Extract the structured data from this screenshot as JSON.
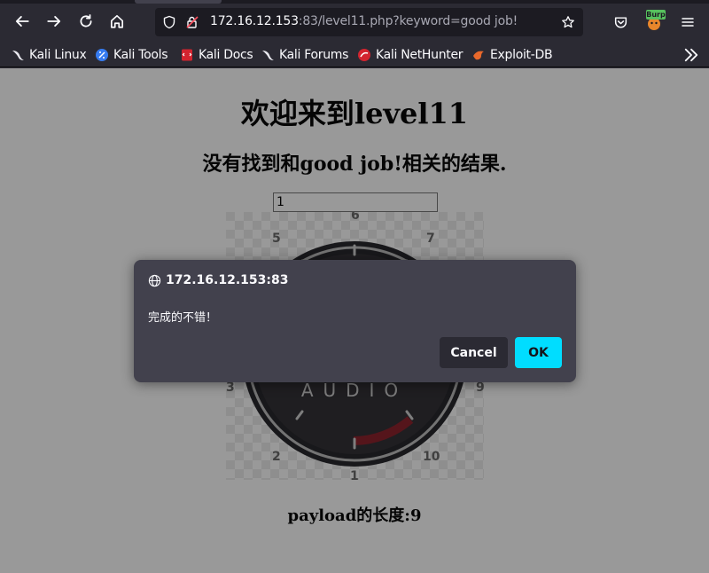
{
  "browser": {
    "url_host": "172.16.12.153",
    "url_rest": ":83/level11.php?keyword=good job!",
    "burp_label": "Burp",
    "bookmarks": [
      {
        "label": "Kali Linux",
        "icon": "kali-dragon-icon"
      },
      {
        "label": "Kali Tools",
        "icon": "kali-tools-icon"
      },
      {
        "label": "Kali Docs",
        "icon": "kali-docs-icon"
      },
      {
        "label": "Kali Forums",
        "icon": "kali-forums-icon"
      },
      {
        "label": "Kali NetHunter",
        "icon": "nethunter-icon"
      },
      {
        "label": "Exploit-DB",
        "icon": "exploit-db-icon"
      }
    ]
  },
  "page": {
    "title": "欢迎来到level11",
    "result": "没有找到和good job!相关的结果.",
    "input_value": "1",
    "payload_length": "payload的长度:9"
  },
  "gauge": {
    "label": "AUDIO",
    "ticks": [
      "1",
      "2",
      "3",
      "5",
      "6",
      "7",
      "9",
      "10"
    ]
  },
  "dialog": {
    "origin": "172.16.12.153:83",
    "message": "完成的不错！",
    "cancel_label": "Cancel",
    "ok_label": "OK"
  },
  "colors": {
    "ok_button": "#00ddff",
    "dialog_bg": "#42414d",
    "toolbar_bg": "#2b2a33"
  }
}
